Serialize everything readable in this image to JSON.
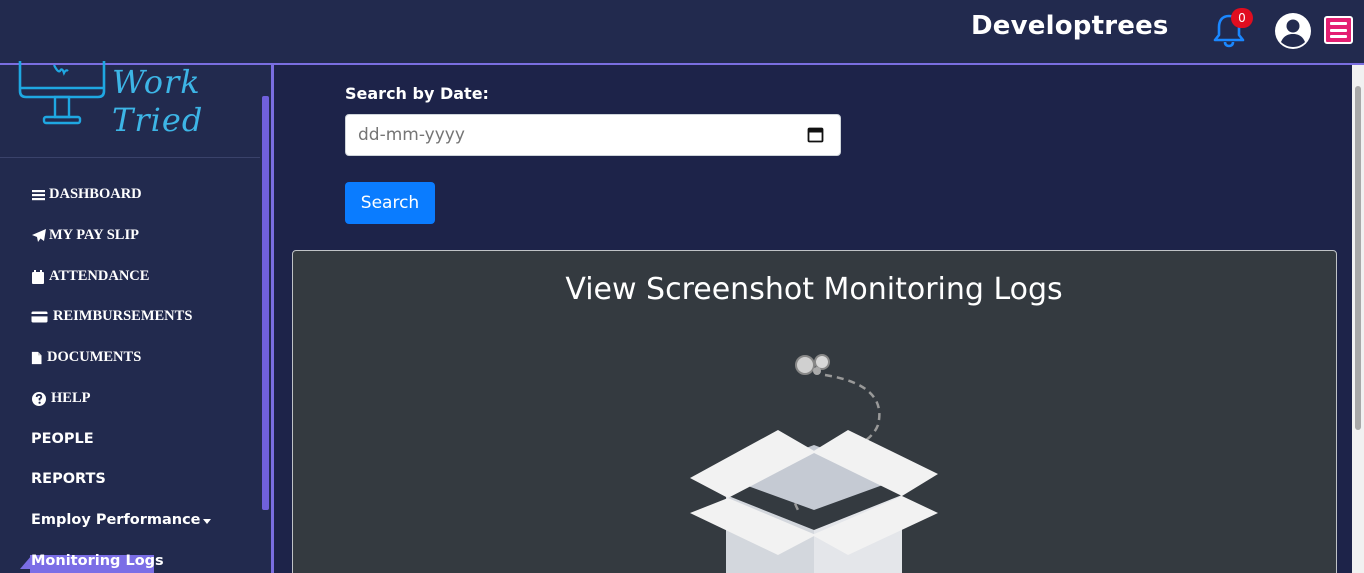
{
  "header": {
    "brand": "Developtrees",
    "notifications_count": "0"
  },
  "sidebar": {
    "logo_text": "Work Tried",
    "items": [
      {
        "label": "DASHBOARD",
        "icon": "bars-icon"
      },
      {
        "label": "MY PAY SLIP",
        "icon": "paper-plane-icon"
      },
      {
        "label": "ATTENDANCE",
        "icon": "calendar-icon"
      },
      {
        "label": "REIMBURSEMENTS",
        "icon": "credit-card-icon"
      },
      {
        "label": "DOCUMENTS",
        "icon": "file-icon"
      },
      {
        "label": "HELP",
        "icon": "question-circle-icon"
      },
      {
        "label": "PEOPLE"
      },
      {
        "label": "REPORTS"
      },
      {
        "label": "Employ Performance",
        "icon": "caret-down-icon"
      },
      {
        "label": "Monitoring Logs"
      }
    ]
  },
  "main": {
    "date_label": "Search by Date:",
    "date_placeholder": "dd-mm-yyyy",
    "search_label": "Search",
    "panel_title": "View Screenshot Monitoring Logs"
  },
  "colors": {
    "background": "#1c2247",
    "sidebar": "#222a4e",
    "accent": "#7a6ee0",
    "primary_button": "#0a7cff",
    "badge": "#e00d1f",
    "menu_button": "#e41f72",
    "panel": "#343a40"
  }
}
